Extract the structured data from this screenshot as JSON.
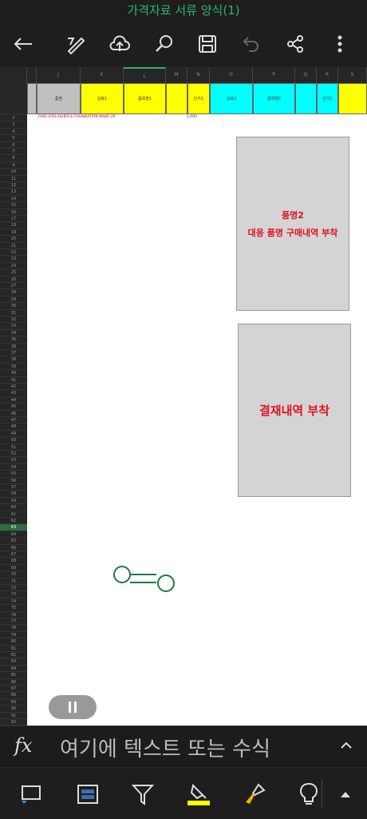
{
  "window": {
    "title": "가격자료 서류 양식(1)"
  },
  "toolbar": {
    "back": "back-icon",
    "pen": "pen-icon",
    "cloud": "cloud-upload-icon",
    "search": "search-icon",
    "save": "save-icon",
    "undo": "undo-icon",
    "share": "share-icon",
    "more": "more-icon"
  },
  "sheet": {
    "columns": [
      "J",
      "K",
      "L",
      "M",
      "N",
      "O",
      "P",
      "Q",
      "R",
      "S"
    ],
    "header_cells": [
      "품명",
      "상표1",
      "품목명1",
      "단가1",
      "상표2",
      "품목명2",
      "단가2"
    ],
    "data_row_text": "FAKE EYELASHES & FOUNDATION MAKE UP",
    "data_row_value": "1,000",
    "box1": {
      "line1": "품명2",
      "line2": "대응 품명 구매내역 부착"
    },
    "box2": {
      "text": "결재내역 부착"
    },
    "selected_row": "63"
  },
  "formula": {
    "fx_label": "fx",
    "placeholder": "여기에 텍스트 또는 수식"
  },
  "colors": {
    "accent": "#2fb36a",
    "yellow": "#ffff00",
    "cyan": "#00ffff",
    "gray_cell": "#c0c0c0",
    "red_text": "#e0141e"
  }
}
